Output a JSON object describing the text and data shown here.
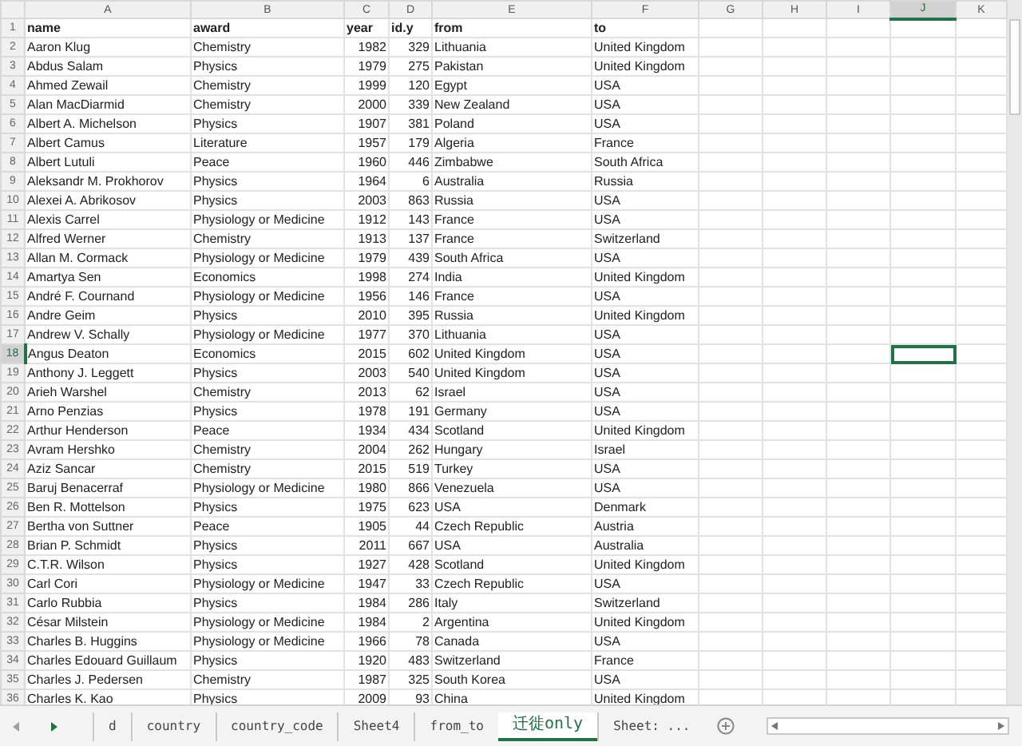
{
  "column_headers": [
    {
      "label": "A",
      "selected": false
    },
    {
      "label": "B",
      "selected": false
    },
    {
      "label": "C",
      "selected": false
    },
    {
      "label": "D",
      "selected": false
    },
    {
      "label": "E",
      "selected": false
    },
    {
      "label": "F",
      "selected": false
    },
    {
      "label": "G",
      "selected": false
    },
    {
      "label": "H",
      "selected": false
    },
    {
      "label": "I",
      "selected": false
    },
    {
      "label": "J",
      "selected": true
    },
    {
      "label": "K",
      "selected": false
    }
  ],
  "rows": [
    {
      "number": "1",
      "kind": "header",
      "selected": false,
      "cells": [
        "name",
        "award",
        "year",
        "id.y",
        "from",
        "to"
      ]
    },
    {
      "number": "2",
      "kind": "data",
      "selected": false,
      "cells": [
        "Aaron Klug",
        "Chemistry",
        "1982",
        "329",
        "Lithuania",
        "United Kingdom"
      ]
    },
    {
      "number": "3",
      "kind": "data",
      "selected": false,
      "cells": [
        "Abdus Salam",
        "Physics",
        "1979",
        "275",
        "Pakistan",
        "United Kingdom"
      ]
    },
    {
      "number": "4",
      "kind": "data",
      "selected": false,
      "cells": [
        "Ahmed Zewail",
        "Chemistry",
        "1999",
        "120",
        "Egypt",
        "USA"
      ]
    },
    {
      "number": "5",
      "kind": "data",
      "selected": false,
      "cells": [
        "Alan MacDiarmid",
        "Chemistry",
        "2000",
        "339",
        "New Zealand",
        "USA"
      ]
    },
    {
      "number": "6",
      "kind": "data",
      "selected": false,
      "cells": [
        "Albert A. Michelson",
        "Physics",
        "1907",
        "381",
        "Poland",
        "USA"
      ]
    },
    {
      "number": "7",
      "kind": "data",
      "selected": false,
      "cells": [
        "Albert Camus",
        "Literature",
        "1957",
        "179",
        "Algeria",
        "France"
      ]
    },
    {
      "number": "8",
      "kind": "data",
      "selected": false,
      "cells": [
        "Albert Lutuli",
        "Peace",
        "1960",
        "446",
        "Zimbabwe",
        "South Africa"
      ]
    },
    {
      "number": "9",
      "kind": "data",
      "selected": false,
      "cells": [
        "Aleksandr M. Prokhorov",
        "Physics",
        "1964",
        "6",
        "Australia",
        "Russia"
      ]
    },
    {
      "number": "10",
      "kind": "data",
      "selected": false,
      "cells": [
        "Alexei A. Abrikosov",
        "Physics",
        "2003",
        "863",
        "Russia",
        "USA"
      ]
    },
    {
      "number": "11",
      "kind": "data",
      "selected": false,
      "cells": [
        "Alexis Carrel",
        "Physiology or Medicine",
        "1912",
        "143",
        "France",
        "USA"
      ]
    },
    {
      "number": "12",
      "kind": "data",
      "selected": false,
      "cells": [
        "Alfred Werner",
        "Chemistry",
        "1913",
        "137",
        "France",
        "Switzerland"
      ]
    },
    {
      "number": "13",
      "kind": "data",
      "selected": false,
      "cells": [
        "Allan M. Cormack",
        "Physiology or Medicine",
        "1979",
        "439",
        "South Africa",
        "USA"
      ]
    },
    {
      "number": "14",
      "kind": "data",
      "selected": false,
      "cells": [
        "Amartya Sen",
        "Economics",
        "1998",
        "274",
        "India",
        "United Kingdom"
      ]
    },
    {
      "number": "15",
      "kind": "data",
      "selected": false,
      "cells": [
        "André F. Cournand",
        "Physiology or Medicine",
        "1956",
        "146",
        "France",
        "USA"
      ]
    },
    {
      "number": "16",
      "kind": "data",
      "selected": false,
      "cells": [
        "Andre Geim",
        "Physics",
        "2010",
        "395",
        "Russia",
        "United Kingdom"
      ]
    },
    {
      "number": "17",
      "kind": "data",
      "selected": false,
      "cells": [
        "Andrew V. Schally",
        "Physiology or Medicine",
        "1977",
        "370",
        "Lithuania",
        "USA"
      ]
    },
    {
      "number": "18",
      "kind": "data",
      "selected": true,
      "cells": [
        "Angus Deaton",
        "Economics",
        "2015",
        "602",
        "United Kingdom",
        "USA"
      ]
    },
    {
      "number": "19",
      "kind": "data",
      "selected": false,
      "cells": [
        "Anthony J. Leggett",
        "Physics",
        "2003",
        "540",
        "United Kingdom",
        "USA"
      ]
    },
    {
      "number": "20",
      "kind": "data",
      "selected": false,
      "cells": [
        "Arieh Warshel",
        "Chemistry",
        "2013",
        "62",
        "Israel",
        "USA"
      ]
    },
    {
      "number": "21",
      "kind": "data",
      "selected": false,
      "cells": [
        "Arno Penzias",
        "Physics",
        "1978",
        "191",
        "Germany",
        "USA"
      ]
    },
    {
      "number": "22",
      "kind": "data",
      "selected": false,
      "cells": [
        "Arthur Henderson",
        "Peace",
        "1934",
        "434",
        "Scotland",
        "United Kingdom"
      ]
    },
    {
      "number": "23",
      "kind": "data",
      "selected": false,
      "cells": [
        "Avram Hershko",
        "Chemistry",
        "2004",
        "262",
        "Hungary",
        "Israel"
      ]
    },
    {
      "number": "24",
      "kind": "data",
      "selected": false,
      "cells": [
        "Aziz Sancar",
        "Chemistry",
        "2015",
        "519",
        "Turkey",
        "USA"
      ]
    },
    {
      "number": "25",
      "kind": "data",
      "selected": false,
      "cells": [
        "Baruj Benacerraf",
        "Physiology or Medicine",
        "1980",
        "866",
        "Venezuela",
        "USA"
      ]
    },
    {
      "number": "26",
      "kind": "data",
      "selected": false,
      "cells": [
        "Ben R. Mottelson",
        "Physics",
        "1975",
        "623",
        "USA",
        "Denmark"
      ]
    },
    {
      "number": "27",
      "kind": "data",
      "selected": false,
      "cells": [
        "Bertha von Suttner",
        "Peace",
        "1905",
        "44",
        "Czech Republic",
        "Austria"
      ]
    },
    {
      "number": "28",
      "kind": "data",
      "selected": false,
      "cells": [
        "Brian P. Schmidt",
        "Physics",
        "2011",
        "667",
        "USA",
        "Australia"
      ]
    },
    {
      "number": "29",
      "kind": "data",
      "selected": false,
      "cells": [
        "C.T.R. Wilson",
        "Physics",
        "1927",
        "428",
        "Scotland",
        "United Kingdom"
      ]
    },
    {
      "number": "30",
      "kind": "data",
      "selected": false,
      "cells": [
        "Carl Cori",
        "Physiology or Medicine",
        "1947",
        "33",
        "Czech Republic",
        "USA"
      ]
    },
    {
      "number": "31",
      "kind": "data",
      "selected": false,
      "cells": [
        "Carlo Rubbia",
        "Physics",
        "1984",
        "286",
        "Italy",
        "Switzerland"
      ]
    },
    {
      "number": "32",
      "kind": "data",
      "selected": false,
      "cells": [
        "César Milstein",
        "Physiology or Medicine",
        "1984",
        "2",
        "Argentina",
        "United Kingdom"
      ]
    },
    {
      "number": "33",
      "kind": "data",
      "selected": false,
      "cells": [
        "Charles B. Huggins",
        "Physiology or Medicine",
        "1966",
        "78",
        "Canada",
        "USA"
      ]
    },
    {
      "number": "34",
      "kind": "data",
      "selected": false,
      "cells": [
        "Charles Edouard Guillaum",
        "Physics",
        "1920",
        "483",
        "Switzerland",
        "France"
      ]
    },
    {
      "number": "35",
      "kind": "data",
      "selected": false,
      "cells": [
        "Charles J. Pedersen",
        "Chemistry",
        "1987",
        "325",
        "South Korea",
        "USA"
      ]
    },
    {
      "number": "36",
      "kind": "data",
      "selected": false,
      "cells": [
        "Charles K. Kao",
        "Physics",
        "2009",
        "93",
        "China",
        "United Kingdom"
      ]
    }
  ],
  "sheet_tabs": [
    {
      "label": "d",
      "selected": false
    },
    {
      "label": "country",
      "selected": false
    },
    {
      "label": "country_code",
      "selected": false
    },
    {
      "label": "Sheet4",
      "selected": false
    },
    {
      "label": "from_to",
      "selected": false
    },
    {
      "label": "迁徙only",
      "selected": true
    },
    {
      "label": "Sheet: ...",
      "selected": false
    }
  ]
}
